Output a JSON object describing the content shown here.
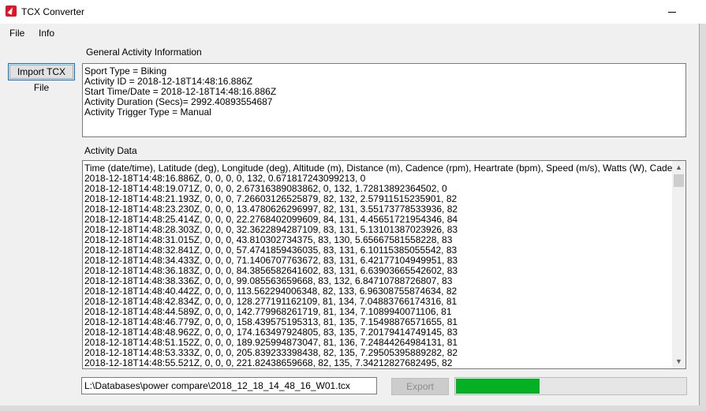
{
  "window": {
    "title": "TCX Converter"
  },
  "menu": {
    "items": [
      "File",
      "Info"
    ]
  },
  "general": {
    "label": "General Activity Information",
    "lines": [
      "Sport Type = Biking",
      "Activity ID = 2018-12-18T14:48:16.886Z",
      "Start Time/Date = 2018-12-18T14:48:16.886Z",
      "Activity Duration (Secs)= 2992.40893554687",
      "Activity Trigger Type = Manual"
    ]
  },
  "import_button": {
    "label": "Import TCX File"
  },
  "activity": {
    "label": "Activity Data",
    "lines": [
      "Time (date/time), Latitude (deg), Longitude (deg), Altitude (m), Distance (m), Cadence (rpm), Heartrate (bpm), Speed (m/s), Watts (W), Cadence (rpm)",
      "2018-12-18T14:48:16.886Z, 0, 0, 0, 0, 132, 0.671817243099213, 0",
      "2018-12-18T14:48:19.071Z, 0, 0, 0, 2.67316389083862, 0, 132, 1.72813892364502, 0",
      "2018-12-18T14:48:21.193Z, 0, 0, 0, 7.26603126525879, 82, 132, 2.57911515235901, 82",
      "2018-12-18T14:48:23.230Z, 0, 0, 0, 13.4780626296997, 82, 131, 3.55173778533936, 82",
      "2018-12-18T14:48:25.414Z, 0, 0, 0, 22.2768402099609, 84, 131, 4.45651721954346, 84",
      "2018-12-18T14:48:28.303Z, 0, 0, 0, 32.3622894287109, 83, 131, 5.13101387023926, 83",
      "2018-12-18T14:48:31.015Z, 0, 0, 0, 43.810302734375, 83, 130, 5.65667581558228, 83",
      "2018-12-18T14:48:32.841Z, 0, 0, 0, 57.4741859436035, 83, 131, 6.10115385055542, 83",
      "2018-12-18T14:48:34.433Z, 0, 0, 0, 71.1406707763672, 83, 131, 6.42177104949951, 83",
      "2018-12-18T14:48:36.183Z, 0, 0, 0, 84.3856582641602, 83, 131, 6.63903665542602, 83",
      "2018-12-18T14:48:38.336Z, 0, 0, 0, 99.085563659668, 83, 132, 6.84710788726807, 83",
      "2018-12-18T14:48:40.442Z, 0, 0, 0, 113.562294006348, 82, 133, 6.96308755874634, 82",
      "2018-12-18T14:48:42.834Z, 0, 0, 0, 128.277191162109, 81, 134, 7.04883766174316, 81",
      "2018-12-18T14:48:44.589Z, 0, 0, 0, 142.779968261719, 81, 134, 7.1089940071106, 81",
      "2018-12-18T14:48:46.779Z, 0, 0, 0, 158.439575195313, 81, 135, 7.15498876571655, 81",
      "2018-12-18T14:48:48.962Z, 0, 0, 0, 174.163497924805, 83, 135, 7.20179414749145, 83",
      "2018-12-18T14:48:51.152Z, 0, 0, 0, 189.925994873047, 81, 136, 7.24844264984131, 81",
      "2018-12-18T14:48:53.333Z, 0, 0, 0, 205.839233398438, 82, 135, 7.29505395889282, 82",
      "2018-12-18T14:48:55.521Z, 0, 0, 0, 221.82438659668, 82, 135, 7.34212827682495, 82"
    ]
  },
  "output": {
    "path": "L:\\Databases\\power compare\\2018_12_18_14_48_16_W01.tcx",
    "export_label": "Export",
    "progress_fraction": 0.37
  },
  "colors": {
    "progress": "#06b025",
    "focus_border": "#0078d7"
  }
}
